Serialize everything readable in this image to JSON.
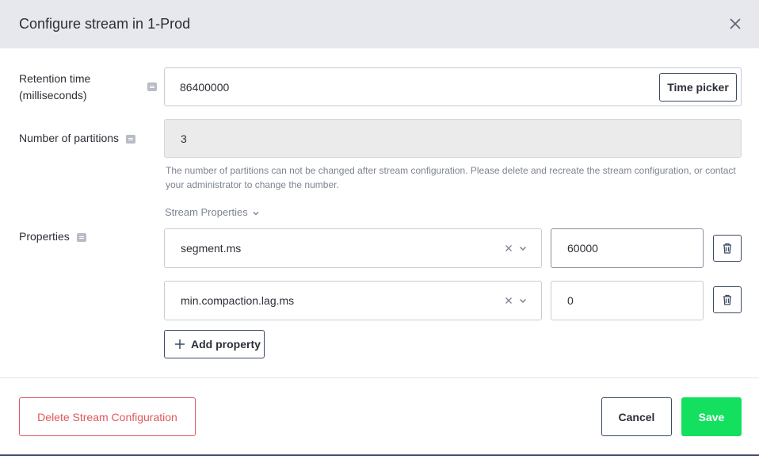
{
  "dialog": {
    "title": "Configure stream in 1-Prod"
  },
  "retention": {
    "label_line1": "Retention time",
    "label_line2": "(milliseconds)",
    "value": "86400000",
    "time_picker_label": "Time picker"
  },
  "partitions": {
    "label": "Number of partitions",
    "value": "3",
    "help_text": "The number of partitions can not be changed after stream configuration. Please delete and recreate the stream configuration, or contact your administrator to change the number."
  },
  "properties": {
    "label": "Properties",
    "section_label": "Stream Properties",
    "items": [
      {
        "key": "segment.ms",
        "value": "60000"
      },
      {
        "key": "min.compaction.lag.ms",
        "value": "0"
      }
    ],
    "add_label": "Add property"
  },
  "footer": {
    "delete_label": "Delete Stream Configuration",
    "cancel_label": "Cancel",
    "save_label": "Save"
  },
  "colors": {
    "danger": "#e0575b",
    "primary": "#14e060",
    "header_bg": "#e6e8ee"
  }
}
